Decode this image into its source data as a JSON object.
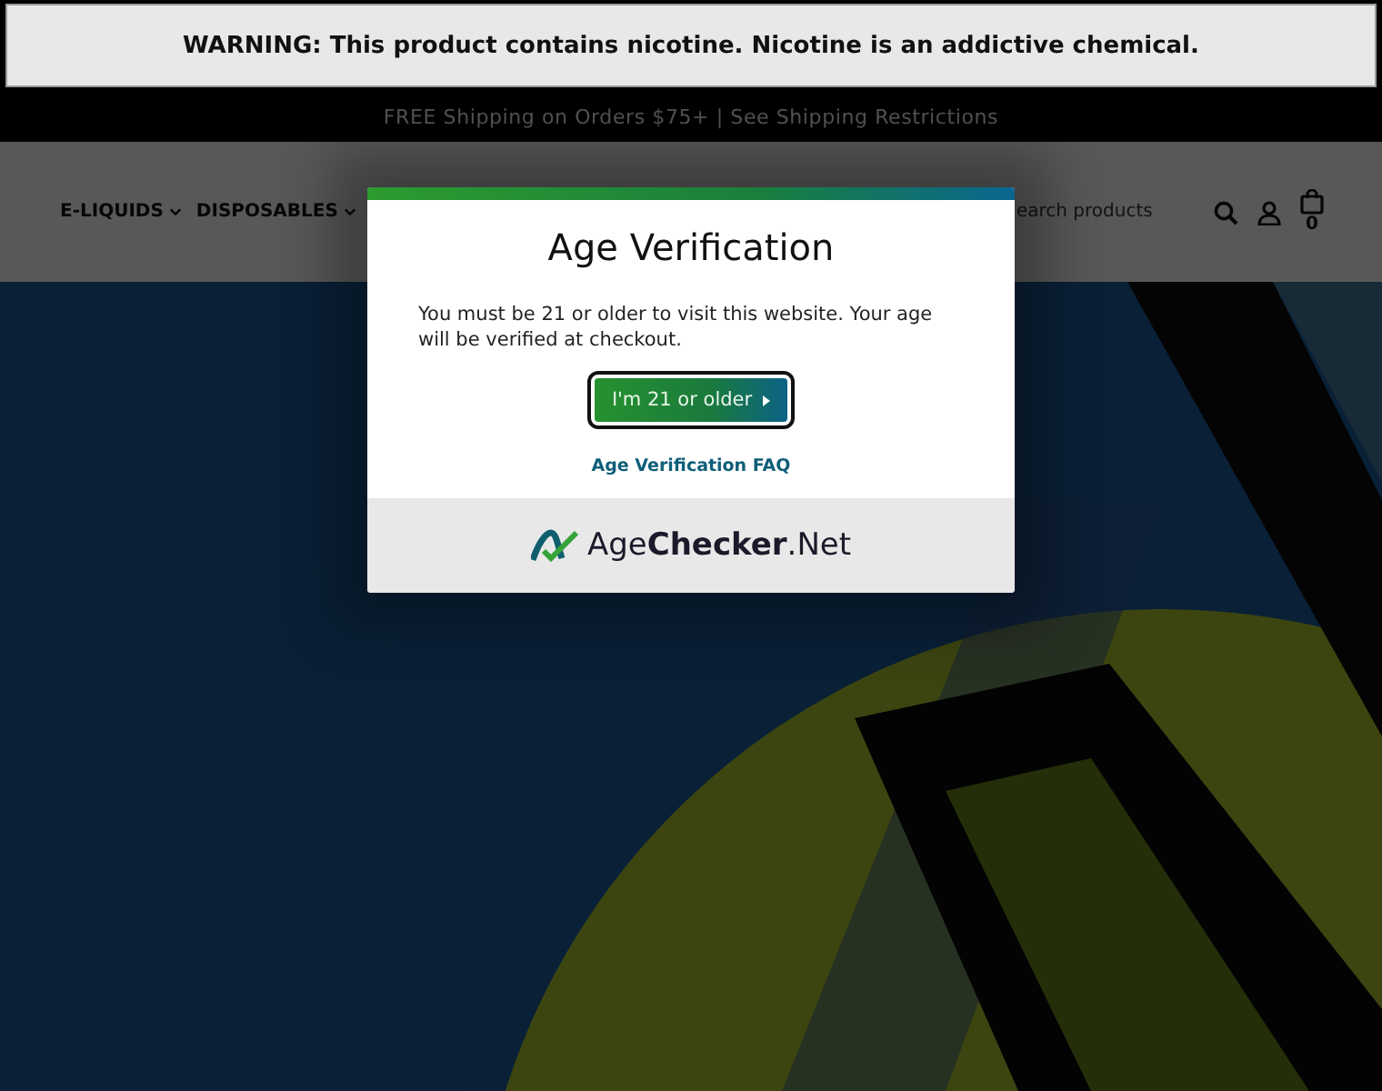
{
  "warning": {
    "text": "WARNING: This product contains nicotine. Nicotine is an addictive chemical."
  },
  "promo_bar": {
    "text": "FREE Shipping on Orders $75+ | See Shipping Restrictions"
  },
  "nav": {
    "items": [
      {
        "label": "E-LIQUIDS",
        "has_dropdown": true
      },
      {
        "label": "DISPOSABLES",
        "has_dropdown": true
      }
    ]
  },
  "search": {
    "placeholder": "earch products"
  },
  "cart": {
    "count": "0"
  },
  "modal": {
    "title": "Age Verification",
    "message": "You must be 21 or older to visit this website. Your age will be verified at checkout.",
    "confirm_button": "I'm 21 or older",
    "faq_link": "Age Verification FAQ",
    "brand": {
      "part1": "Age",
      "part2": "Checker",
      "part3": ".Net"
    }
  }
}
